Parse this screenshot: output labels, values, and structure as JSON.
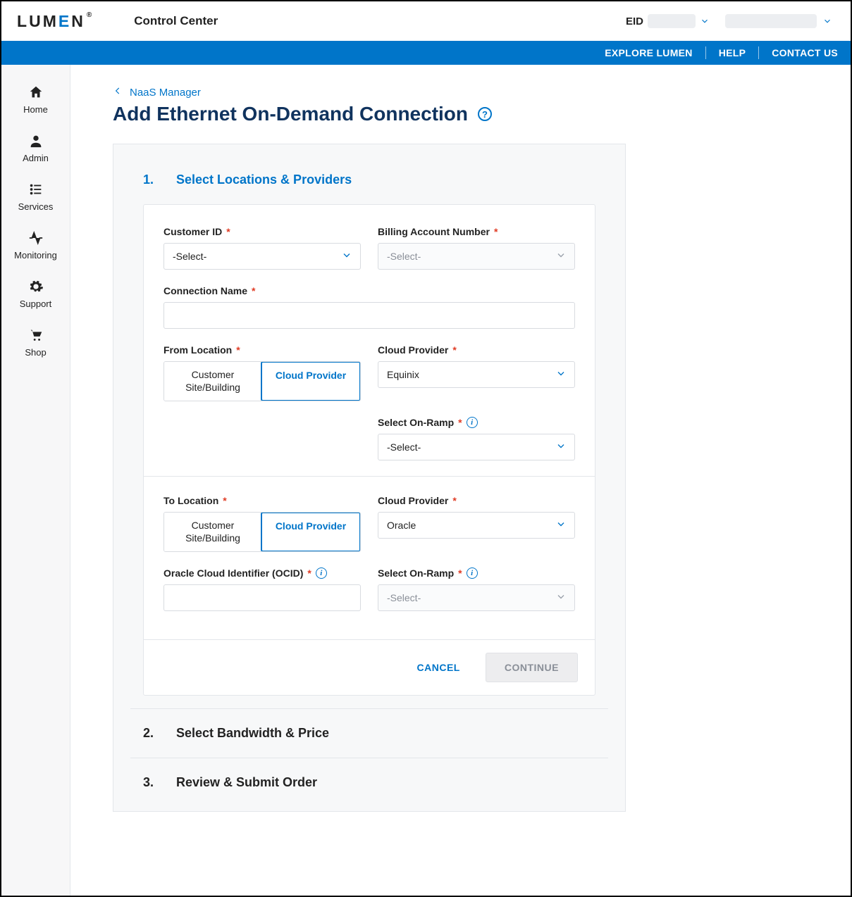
{
  "header": {
    "logo_text": "LUMEN",
    "app_title": "Control Center",
    "eid_label": "EID"
  },
  "topbar": {
    "explore": "EXPLORE LUMEN",
    "help": "HELP",
    "contact": "CONTACT US"
  },
  "sidebar": {
    "items": [
      {
        "label": "Home",
        "icon": "home"
      },
      {
        "label": "Admin",
        "icon": "user"
      },
      {
        "label": "Services",
        "icon": "list"
      },
      {
        "label": "Monitoring",
        "icon": "activity"
      },
      {
        "label": "Support",
        "icon": "gear"
      },
      {
        "label": "Shop",
        "icon": "cart"
      }
    ]
  },
  "breadcrumb": {
    "back": "NaaS Manager"
  },
  "page": {
    "title": "Add Ethernet On-Demand Connection"
  },
  "steps": {
    "s1": {
      "num": "1.",
      "title": "Select Locations & Providers"
    },
    "s2": {
      "num": "2.",
      "title": "Select Bandwidth & Price"
    },
    "s3": {
      "num": "3.",
      "title": "Review & Submit Order"
    }
  },
  "form": {
    "customer_id": {
      "label": "Customer ID",
      "value": "-Select-"
    },
    "ban": {
      "label": "Billing Account Number",
      "placeholder": "-Select-"
    },
    "conn_name": {
      "label": "Connection Name",
      "value": ""
    },
    "from_loc": {
      "label": "From Location",
      "opt_a": "Customer Site/Building",
      "opt_b": "Cloud Provider"
    },
    "from_cloud_provider": {
      "label": "Cloud Provider",
      "value": "Equinix"
    },
    "from_onramp": {
      "label": "Select On-Ramp",
      "value": "-Select-"
    },
    "to_loc": {
      "label": "To Location",
      "opt_a": "Customer Site/Building",
      "opt_b": "Cloud Provider"
    },
    "to_cloud_provider": {
      "label": "Cloud Provider",
      "value": "Oracle"
    },
    "ocid": {
      "label": "Oracle Cloud Identifier (OCID)",
      "value": ""
    },
    "to_onramp": {
      "label": "Select On-Ramp",
      "placeholder": "-Select-"
    },
    "cancel": "CANCEL",
    "continue": "CONTINUE"
  }
}
